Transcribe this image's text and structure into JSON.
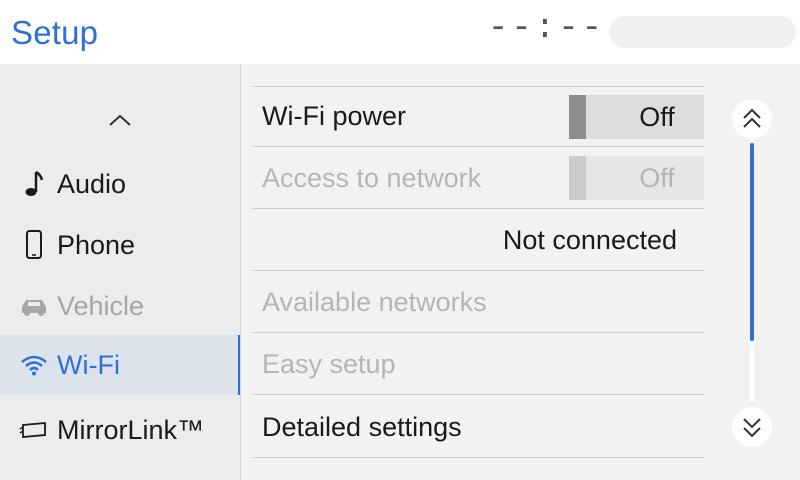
{
  "header": {
    "title": "Setup",
    "clock": "--:--"
  },
  "sidebar": {
    "up_icon": "chevron-up-icon",
    "items": [
      {
        "label": "Audio",
        "icon": "music-note-icon",
        "state": "normal"
      },
      {
        "label": "Phone",
        "icon": "phone-icon",
        "state": "normal"
      },
      {
        "label": "Vehicle",
        "icon": "car-icon",
        "state": "disabled"
      },
      {
        "label": "Wi-Fi",
        "icon": "wifi-icon",
        "state": "active"
      },
      {
        "label": "MirrorLink™",
        "icon": "mirrorlink-icon",
        "state": "normal"
      }
    ]
  },
  "main": {
    "rows": [
      {
        "label": "Wi-Fi power",
        "toggle": "Off",
        "state": "enabled"
      },
      {
        "label": "Access to network",
        "toggle": "Off",
        "state": "disabled"
      },
      {
        "value": "Not connected"
      },
      {
        "label": "Available networks",
        "state": "disabled"
      },
      {
        "label": "Easy setup",
        "state": "disabled"
      },
      {
        "label": "Detailed settings",
        "state": "enabled"
      }
    ]
  },
  "scroll": {
    "up_icon": "double-chevron-up-icon",
    "down_icon": "double-chevron-down-icon",
    "position_fraction": 0.0
  },
  "colors": {
    "accent": "#2f6fd8",
    "background": "#f2f2f2",
    "sidebar": "#ececec",
    "active_item": "#dde3ec",
    "disabled_text": "#b5b5b5"
  }
}
